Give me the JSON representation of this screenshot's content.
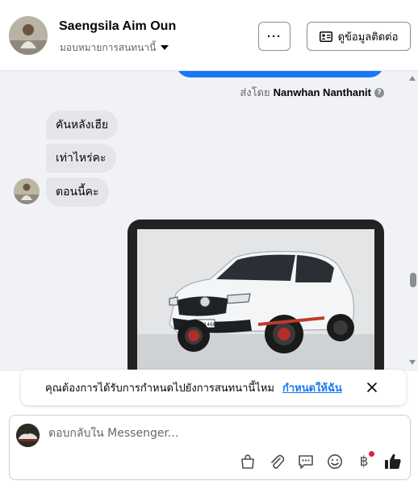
{
  "header": {
    "name": "Saengsila Aim Oun",
    "subtitle": "มอบหมายการสนทนานี้",
    "more_label": "···",
    "contact_label": "ดูข้อมูลติดต่อ"
  },
  "chat": {
    "sent_by_prefix": "ส่งโดย",
    "sent_by_name": "Nanwhan Nanthanit",
    "help_glyph": "?",
    "messages": [
      {
        "text": "คันหลังเฮีย"
      },
      {
        "text": "เท่าไหร่คะ"
      },
      {
        "text": "ตอนนี้คะ"
      }
    ],
    "plate_text": "2ขข 1468"
  },
  "notice": {
    "text": "คุณต้องการได้รับการกำหนดไปยังการสนทนานี้ไหม",
    "link": "กำหนดให้ฉัน"
  },
  "composer": {
    "placeholder": "ตอบกลับใน Messenger...",
    "baht": "฿"
  },
  "colors": {
    "accent": "#1877f2",
    "bubble": "#e4e6eb",
    "chat_bg": "#f0f2f5",
    "notify_dot": "#e41e3f"
  },
  "icons": {
    "more": "more-dots-icon",
    "contact": "contact-card-icon",
    "dropdown": "caret-down-icon",
    "help": "help-circle-icon",
    "close": "close-icon",
    "shop": "shopping-bag-icon",
    "attach": "paperclip-icon",
    "quick_reply": "chat-bubble-icon",
    "emoji": "emoji-icon",
    "payment": "baht-icon",
    "like": "thumbs-up-icon"
  }
}
